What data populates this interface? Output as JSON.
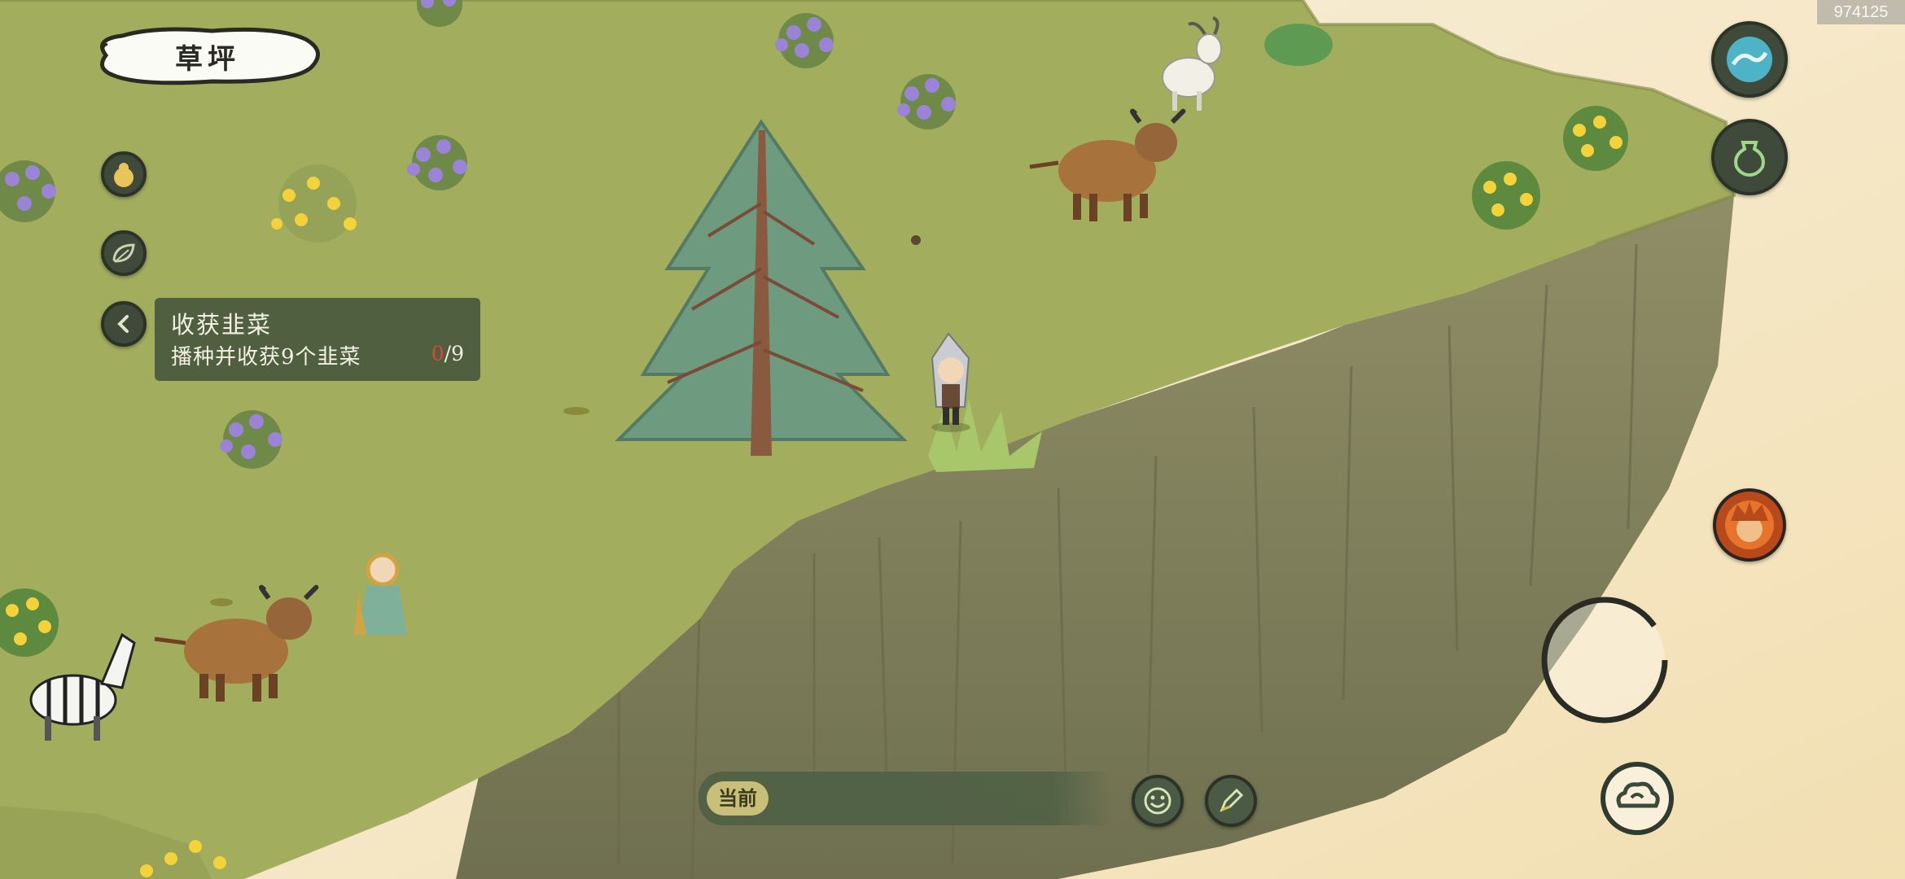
{
  "location": {
    "title": "草坪"
  },
  "quest": {
    "title": "收获韭菜",
    "description": "播种并收获9个韭菜",
    "progress_current": "0",
    "progress_total": "/9"
  },
  "chat": {
    "channel_label": "当前"
  },
  "build_id": "974125",
  "left_buttons": [
    {
      "name": "gourd-pouch-icon"
    },
    {
      "name": "leaf-icon"
    },
    {
      "name": "collapse-quest-chevron-icon"
    }
  ],
  "right_buttons": [
    {
      "name": "water-wave-skill-icon"
    },
    {
      "name": "jar-item-icon"
    },
    {
      "name": "hero-portrait-icon"
    },
    {
      "name": "jump-cloud-icon"
    }
  ],
  "colors": {
    "grass": "#a3ad5e",
    "cliff": "#8a8a62",
    "sky": "#f6ead0",
    "button_dark": "#3f4a3a",
    "progress_red": "#d94a35"
  }
}
